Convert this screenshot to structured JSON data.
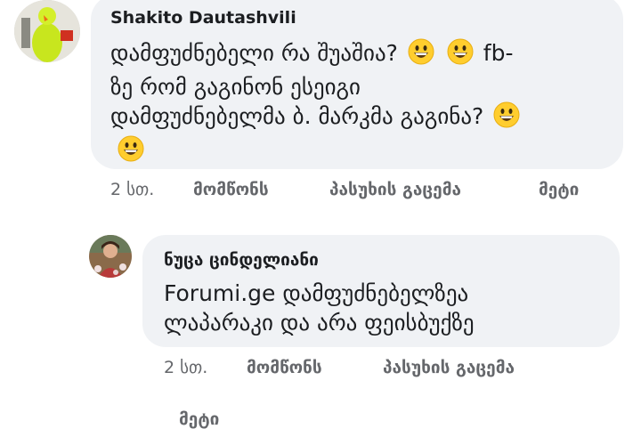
{
  "comment1": {
    "author": "Shakito Dautashvili",
    "line1": "დამფუძნებელი რა შუაშია?",
    "line1_tail": "fb-",
    "line2": "ზე რომ გაგინონ ესეიგი",
    "line3": "დამფუძნებელმა ბ. მარკმა გაგინა?",
    "time": "2 სთ.",
    "like": "მომწონს",
    "reply": "პასუხის გაცემა",
    "more": "მეტი",
    "emoji": "grinning-face-icon"
  },
  "comment2": {
    "author": "ნუცა ცინდელიანი",
    "line1": "Forumi.ge დამფუძნებელზეა",
    "line2": "ლაპარაკი და არა ფეისბუქზე",
    "time": "2 სთ.",
    "like": "მომწონს",
    "reply": "პასუხის გაცემა",
    "more": "მეტი"
  }
}
